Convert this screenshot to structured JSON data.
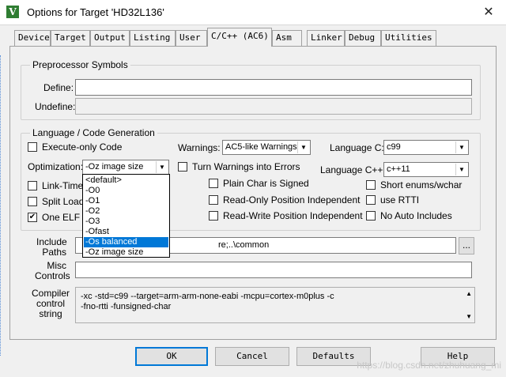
{
  "window": {
    "title": "Options for Target 'HD32L136'",
    "close_glyph": "✕",
    "app_icon_glyph": "V"
  },
  "tabs": [
    "Device",
    "Target",
    "Output",
    "Listing",
    "User",
    "C/C++ (AC6)",
    "Asm",
    "Linker",
    "Debug",
    "Utilities"
  ],
  "active_tab": "C/C++ (AC6)",
  "preprocessor": {
    "title": "Preprocessor Symbols",
    "define_label": "Define:",
    "define_value": "",
    "undefine_label": "Undefine:",
    "undefine_value": ""
  },
  "language": {
    "title": "Language / Code Generation",
    "execute_only_label": "Execute-only Code",
    "optimization_label": "Optimization:",
    "optimization_value": "-Oz image size",
    "link_time_label": "Link-Time C",
    "split_load_label": "Split Load a",
    "one_elf_label": "One ELF S",
    "warnings_label": "Warnings:",
    "warnings_value": "AC5-like Warnings",
    "turn_warnings_label": "Turn Warnings into Errors",
    "plain_char_label": "Plain Char is Signed",
    "ro_pi_label": "Read-Only Position Independent",
    "rw_pi_label": "Read-Write Position Independent",
    "language_c_label": "Language C:",
    "language_c_value": "c99",
    "language_cpp_label": "Language C++:",
    "language_cpp_value": "c++11",
    "short_enums_label": "Short enums/wchar",
    "use_rtti_label": "use RTTI",
    "no_auto_includes_label": "No Auto Includes"
  },
  "optimization_options": [
    "<default>",
    "-O0",
    "-O1",
    "-O2",
    "-O3",
    "-Ofast",
    "-Os balanced",
    "-Oz image size"
  ],
  "optimization_highlighted": "-Os balanced",
  "include": {
    "label_line1": "Include",
    "label_line2": "Paths",
    "value": "re;..\\common",
    "browse_label": "..."
  },
  "misc": {
    "label_line1": "Misc",
    "label_line2": "Controls",
    "value": ""
  },
  "compiler": {
    "label_line1": "Compiler",
    "label_line2": "control",
    "label_line3": "string",
    "line1": "-xc -std=c99 --target=arm-arm-none-eabi -mcpu=cortex-m0plus -c",
    "line2": "-fno-rtti -funsigned-char"
  },
  "buttons": {
    "ok": "OK",
    "cancel": "Cancel",
    "defaults": "Defaults",
    "help": "Help"
  },
  "watermark": "https://blog.csdn.net/zhuhuang_mi",
  "colors": {
    "selection": "#0078d7",
    "default_button_border": "#0078d7"
  }
}
